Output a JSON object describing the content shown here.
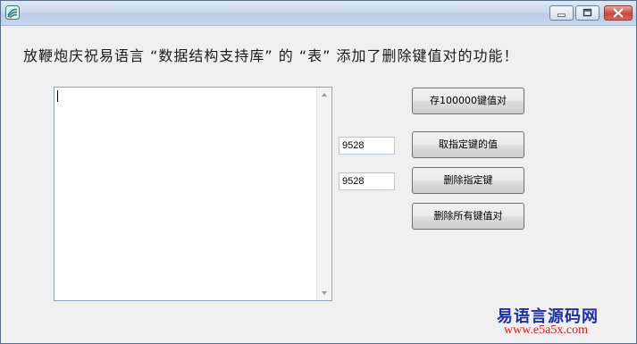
{
  "window": {
    "title": "",
    "controls": {
      "minimize": "minimize-icon",
      "maximize": "maximize-icon",
      "close": "close-icon"
    }
  },
  "header": {
    "text": "放鞭炮庆祝易语言 “数据结构支持库” 的 “表” 添加了删除键值对的功能！"
  },
  "textarea": {
    "value": ""
  },
  "inputs": {
    "key1": "9528",
    "key2": "9528"
  },
  "buttons": {
    "store": "存100000键值对",
    "get": "取指定键的值",
    "delete": "删除指定键",
    "delete_all": "删除所有键值对"
  },
  "watermark": {
    "name": "易语言源码网",
    "url": "www.e5a5x.com"
  },
  "colors": {
    "watermark_name": "#1f2fa8",
    "watermark_url": "#d11a1a",
    "close_button": "#c9463a"
  }
}
